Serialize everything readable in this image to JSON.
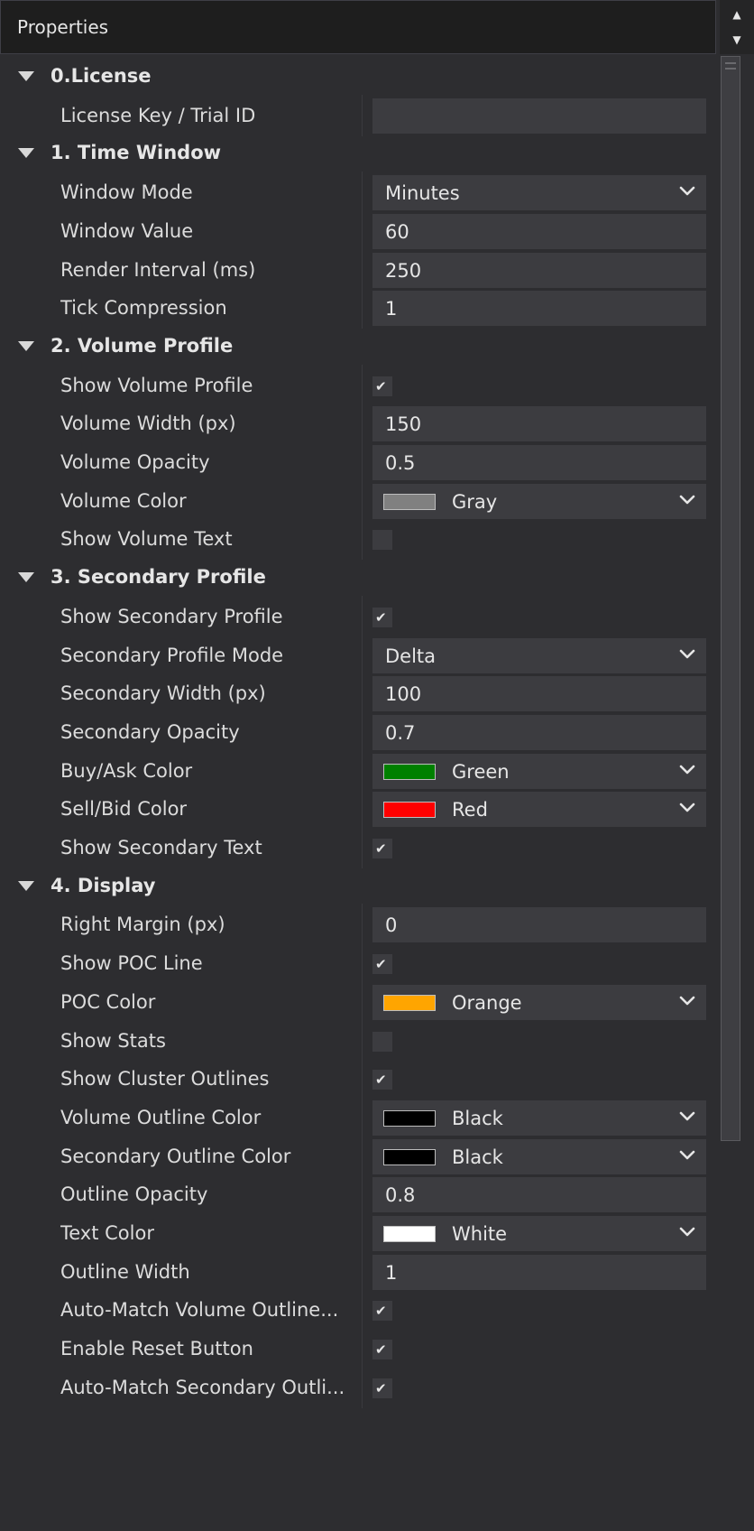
{
  "panel": {
    "title": "Properties"
  },
  "colors": {
    "Gray": "#808080",
    "Green": "#008000",
    "Red": "#ff0000",
    "Orange": "#ffa500",
    "Black": "#000000",
    "White": "#ffffff"
  },
  "rows": [
    {
      "kind": "category",
      "label": "0.License"
    },
    {
      "kind": "text",
      "label": "License Key / Trial ID",
      "value": ""
    },
    {
      "kind": "category",
      "label": "1. Time Window"
    },
    {
      "kind": "select",
      "label": "Window Mode",
      "value": "Minutes"
    },
    {
      "kind": "text",
      "label": "Window Value",
      "value": "60"
    },
    {
      "kind": "text",
      "label": "Render Interval (ms)",
      "value": "250"
    },
    {
      "kind": "text",
      "label": "Tick Compression",
      "value": "1"
    },
    {
      "kind": "category",
      "label": "2. Volume Profile"
    },
    {
      "kind": "check",
      "label": "Show Volume Profile",
      "checked": true
    },
    {
      "kind": "text",
      "label": "Volume Width (px)",
      "value": "150"
    },
    {
      "kind": "text",
      "label": "Volume Opacity",
      "value": "0.5"
    },
    {
      "kind": "color",
      "label": "Volume Color",
      "value": "Gray"
    },
    {
      "kind": "check",
      "label": "Show Volume Text",
      "checked": false
    },
    {
      "kind": "category",
      "label": "3. Secondary Profile"
    },
    {
      "kind": "check",
      "label": "Show Secondary Profile",
      "checked": true
    },
    {
      "kind": "select",
      "label": "Secondary Profile Mode",
      "value": "Delta"
    },
    {
      "kind": "text",
      "label": "Secondary Width (px)",
      "value": "100"
    },
    {
      "kind": "text",
      "label": "Secondary Opacity",
      "value": "0.7"
    },
    {
      "kind": "color",
      "label": "Buy/Ask Color",
      "value": "Green"
    },
    {
      "kind": "color",
      "label": "Sell/Bid Color",
      "value": "Red"
    },
    {
      "kind": "check",
      "label": "Show Secondary Text",
      "checked": true
    },
    {
      "kind": "category",
      "label": "4. Display"
    },
    {
      "kind": "text",
      "label": "Right Margin (px)",
      "value": "0"
    },
    {
      "kind": "check",
      "label": "Show POC Line",
      "checked": true
    },
    {
      "kind": "color",
      "label": "POC Color",
      "value": "Orange"
    },
    {
      "kind": "check",
      "label": "Show Stats",
      "checked": false
    },
    {
      "kind": "check",
      "label": "Show Cluster Outlines",
      "checked": true
    },
    {
      "kind": "color",
      "label": "Volume Outline Color",
      "value": "Black"
    },
    {
      "kind": "color",
      "label": "Secondary Outline Color",
      "value": "Black"
    },
    {
      "kind": "text",
      "label": "Outline Opacity",
      "value": "0.8"
    },
    {
      "kind": "color",
      "label": "Text Color",
      "value": "White"
    },
    {
      "kind": "text",
      "label": "Outline Width",
      "value": "1"
    },
    {
      "kind": "check",
      "label": "Auto-Match Volume Outline...",
      "checked": true
    },
    {
      "kind": "check",
      "label": "Enable Reset Button",
      "checked": true
    },
    {
      "kind": "check",
      "label": "Auto-Match Secondary Outli...",
      "checked": true
    }
  ]
}
